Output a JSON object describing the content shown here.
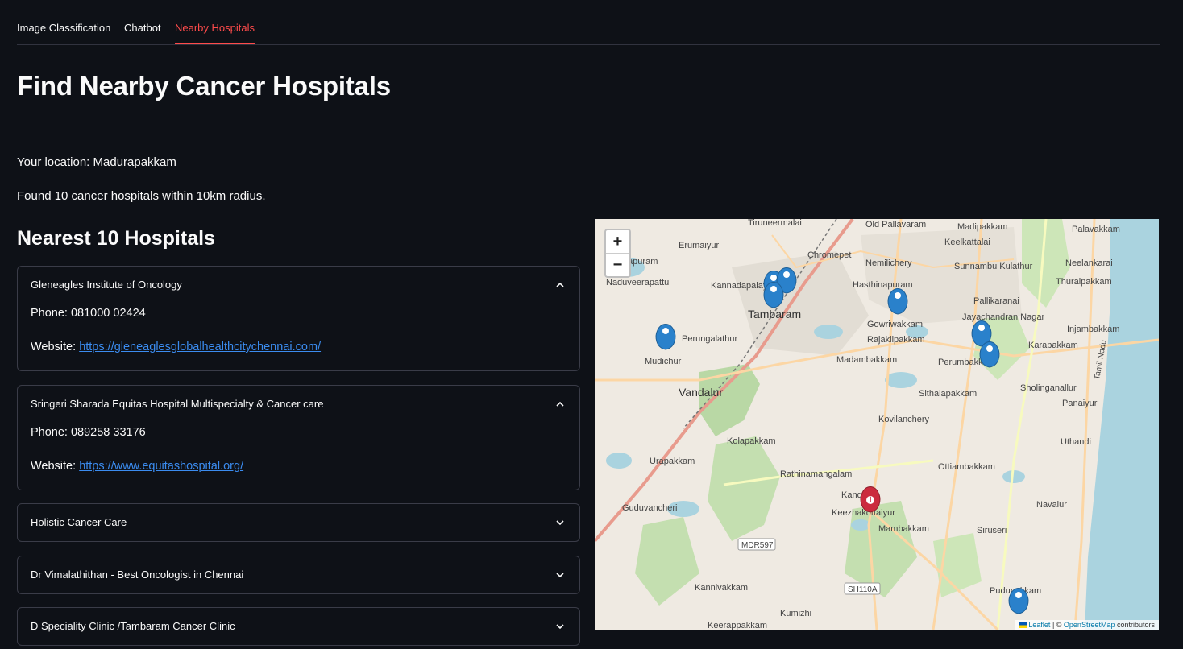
{
  "tabs": [
    {
      "label": "Image Classification"
    },
    {
      "label": "Chatbot"
    },
    {
      "label": "Nearby Hospitals"
    }
  ],
  "title": "Find Nearby Cancer Hospitals",
  "location_text": "Your location: Madurapakkam",
  "found_text": "Found 10 cancer hospitals within 10km radius.",
  "list_heading": "Nearest 10 Hospitals",
  "hospitals": [
    {
      "name": "Gleneagles Institute of Oncology",
      "phone": "Phone: 081000 02424",
      "website_label": "Website: ",
      "website": "https://gleneaglesglobalhealthcitychennai.com/"
    },
    {
      "name": "Sringeri Sharada Equitas Hospital Multispecialty & Cancer care",
      "phone": "Phone: 089258 33176",
      "website_label": "Website: ",
      "website": "https://www.equitashospital.org/"
    },
    {
      "name": "Holistic Cancer Care"
    },
    {
      "name": "Dr Vimalathithan - Best Oncologist in Chennai"
    },
    {
      "name": "D Speciality Clinic /Tambaram Cancer Clinic"
    }
  ],
  "map": {
    "zoom_in": "+",
    "zoom_out": "−",
    "attribution_leaflet": "Leaflet",
    "attribution_sep": " | © ",
    "attribution_osm": "OpenStreetMap",
    "attribution_tail": " contributors",
    "places": [
      {
        "name": "Old Pallavaram"
      },
      {
        "name": "Madipakkam"
      },
      {
        "name": "Palavakkam"
      },
      {
        "name": "Tiruneermalai"
      },
      {
        "name": "Erumaiyur"
      },
      {
        "name": "Keelkattalai"
      },
      {
        "name": "Chromepet"
      },
      {
        "name": "Nemilichery"
      },
      {
        "name": "Sunnambu Kulathur"
      },
      {
        "name": "Neelankarai"
      },
      {
        "name": "Ettayapuram"
      },
      {
        "name": "Naduveerapattu"
      },
      {
        "name": "Kannadapalayam"
      },
      {
        "name": "Hasthinapuram"
      },
      {
        "name": "Pallikaranai"
      },
      {
        "name": "Thuraipakkam"
      },
      {
        "name": "Tambaram"
      },
      {
        "name": "Jayachandran Nagar"
      },
      {
        "name": "Gowriwakkam"
      },
      {
        "name": "Injambakkam"
      },
      {
        "name": "Perungalathur"
      },
      {
        "name": "Rajakilpakkam"
      },
      {
        "name": "Karapakkam"
      },
      {
        "name": "Mudichur"
      },
      {
        "name": "Madambakkam"
      },
      {
        "name": "Perumbakkam"
      },
      {
        "name": "Vandalur"
      },
      {
        "name": "Sithalapakkam"
      },
      {
        "name": "Sholinganallur"
      },
      {
        "name": "Panaiyur"
      },
      {
        "name": "Kovilanchery"
      },
      {
        "name": "Kolapakkam"
      },
      {
        "name": "Uthandi"
      },
      {
        "name": "Urapakkam"
      },
      {
        "name": "Ottiambakkam"
      },
      {
        "name": "Rathinamangalam"
      },
      {
        "name": "Kandigai"
      },
      {
        "name": "Keezhakottaiyur"
      },
      {
        "name": "Navalur"
      },
      {
        "name": "Guduvancheri"
      },
      {
        "name": "Mambakkam"
      },
      {
        "name": "Siruseri"
      },
      {
        "name": "MDR597"
      },
      {
        "name": "SH110A"
      },
      {
        "name": "Kannivakkam"
      },
      {
        "name": "Pudupakkam"
      },
      {
        "name": "Kumizhi"
      },
      {
        "name": "Keerappakkam"
      },
      {
        "name": "Tamil Nadu"
      }
    ],
    "colors": {
      "hospital_marker": "#2a81cb",
      "user_marker": "#cb2b3e"
    }
  }
}
